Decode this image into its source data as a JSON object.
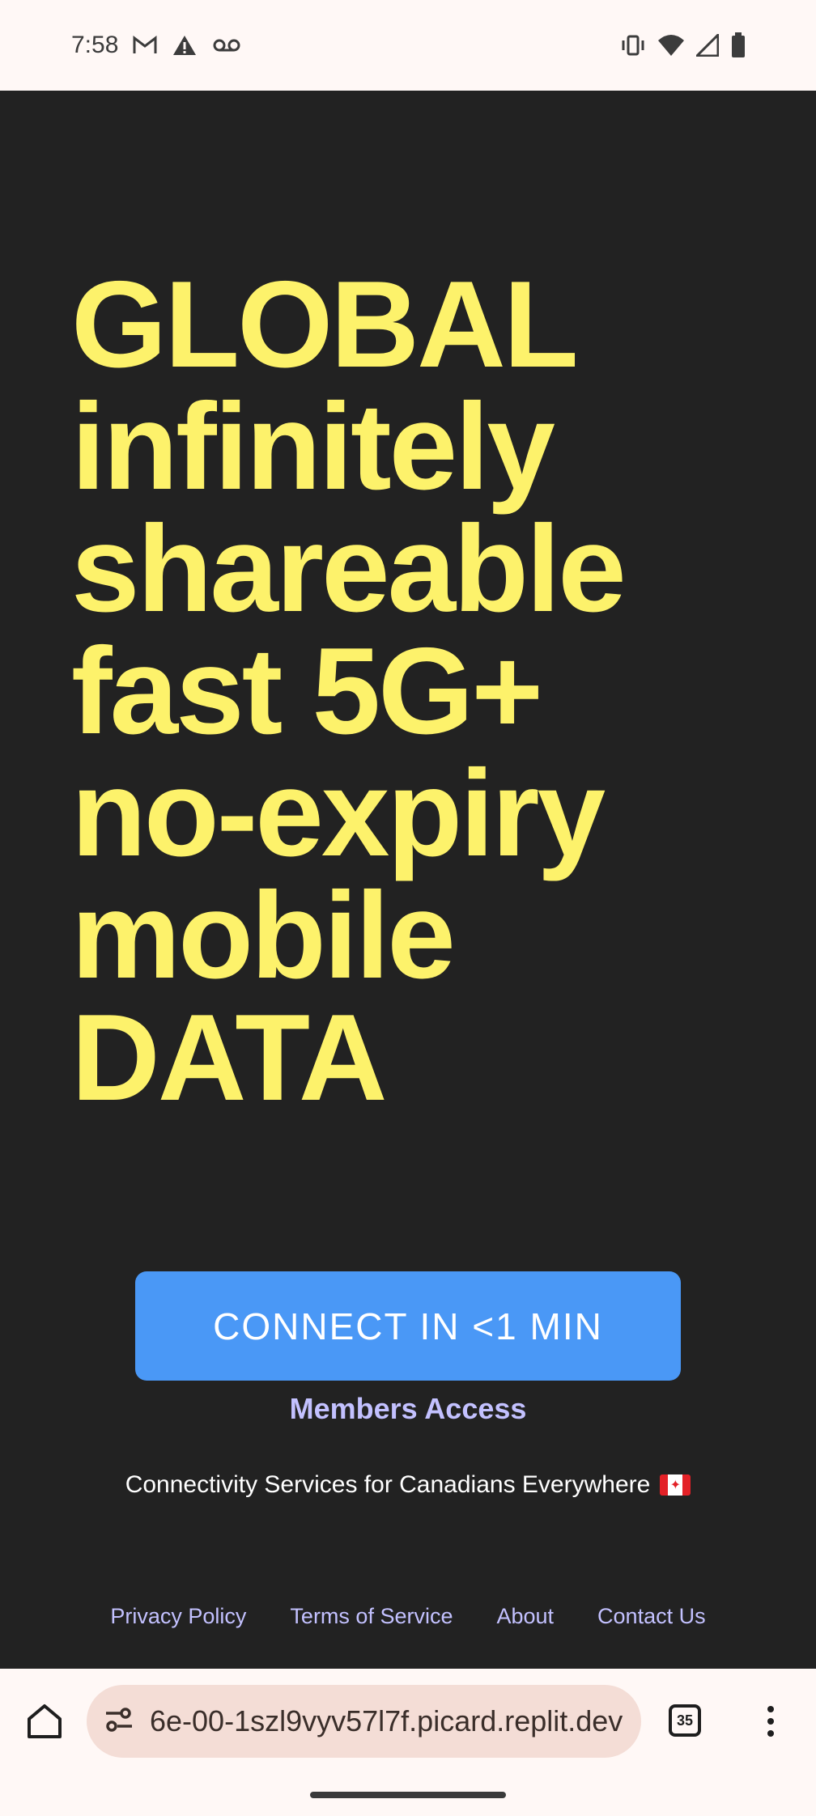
{
  "status_bar": {
    "time": "7:58",
    "left_icons": [
      "gmail-icon",
      "warning-icon",
      "voicemail-icon"
    ],
    "right_icons": [
      "vibrate-icon",
      "wifi-icon",
      "signal-icon",
      "battery-icon"
    ]
  },
  "hero": {
    "lines": [
      "GLOBAL",
      "infinitely",
      "shareable",
      "fast 5G+",
      "no-expiry",
      "mobile",
      "DATA"
    ],
    "color": "#fdf26b"
  },
  "cta": {
    "label": "CONNECT IN <1 MIN",
    "color": "#4a98f6"
  },
  "members_link": "Members Access",
  "tagline": "Connectivity Services for Canadians Everywhere",
  "tagline_icon": "canada-flag-icon",
  "footer": {
    "links": [
      "Privacy Policy",
      "Terms of Service",
      "About",
      "Contact Us"
    ],
    "link_color": "#c3c1ff"
  },
  "browser": {
    "url": "6e-00-1szl9vyv57l7f.picard.replit.dev",
    "tab_count": "35"
  },
  "colors": {
    "background": "#222222",
    "system_bar": "#fff8f6"
  }
}
